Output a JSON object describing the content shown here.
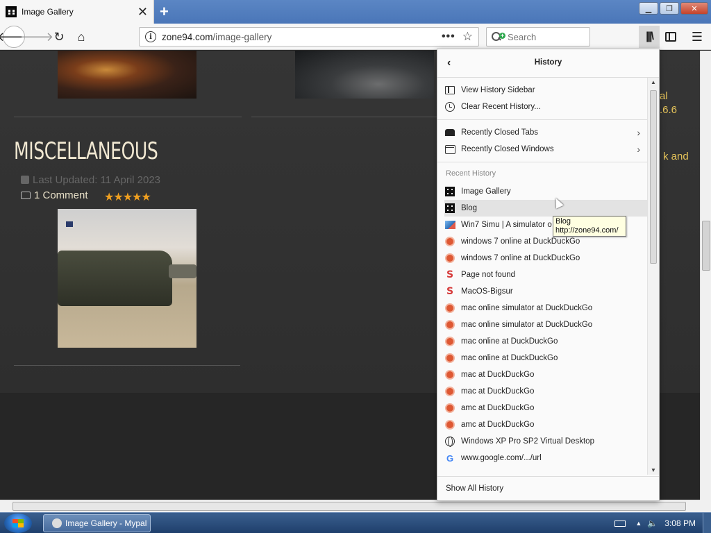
{
  "browser": {
    "tab_title": "Image Gallery",
    "tab_close": "✕",
    "new_tab": "+",
    "url_host": "zone94.com",
    "url_path": "/image-gallery",
    "search_placeholder": "Search",
    "window_controls": {
      "minimize": "▁",
      "maximize": "❐",
      "close": "✕"
    }
  },
  "page": {
    "section_title": "MISCELLANEOUS",
    "last_updated": "Last Updated: 11 April 2023",
    "comments": "1 Comment",
    "rating": "★★★★★",
    "right_snippets": [
      "al",
      ".6.6",
      "k and"
    ]
  },
  "history_panel": {
    "title": "History",
    "actions": [
      {
        "label": "View History Sidebar",
        "icon": "sidebar-icon"
      },
      {
        "label": "Clear Recent History...",
        "icon": "clock-icon"
      }
    ],
    "closed": [
      {
        "label": "Recently Closed Tabs",
        "icon": "tab-icon"
      },
      {
        "label": "Recently Closed Windows",
        "icon": "window-icon"
      }
    ],
    "recent_label": "Recent History",
    "items": [
      {
        "label": "Image Gallery",
        "icon": "zone94"
      },
      {
        "label": "Blog",
        "icon": "zone94",
        "hover": true
      },
      {
        "label": "Win7 Simu | A simulator o",
        "icon": "win7"
      },
      {
        "label": "windows 7 online at DuckDuckGo",
        "icon": "ddg"
      },
      {
        "label": "windows 7 online at DuckDuckGo",
        "icon": "ddg"
      },
      {
        "label": "Page not found",
        "icon": "s"
      },
      {
        "label": "MacOS-Bigsur",
        "icon": "s"
      },
      {
        "label": "mac online simulator at DuckDuckGo",
        "icon": "ddg"
      },
      {
        "label": "mac online simulator at DuckDuckGo",
        "icon": "ddg"
      },
      {
        "label": "mac online at DuckDuckGo",
        "icon": "ddg"
      },
      {
        "label": "mac online at DuckDuckGo",
        "icon": "ddg"
      },
      {
        "label": "mac at DuckDuckGo",
        "icon": "ddg"
      },
      {
        "label": "mac at DuckDuckGo",
        "icon": "ddg"
      },
      {
        "label": "amc at DuckDuckGo",
        "icon": "ddg"
      },
      {
        "label": "amc at DuckDuckGo",
        "icon": "ddg"
      },
      {
        "label": "Windows XP Pro SP2 Virtual Desktop",
        "icon": "globe"
      },
      {
        "label": "www.google.com/.../url",
        "icon": "google"
      }
    ],
    "footer": "Show All History"
  },
  "tooltip": {
    "title": "Blog",
    "url": "http://zone94.com/"
  },
  "taskbar": {
    "task_label": "Image Gallery - Mypal",
    "clock": "3:08 PM"
  },
  "colors": {
    "accent": "#4a76b8",
    "page_bg": "#2b2b2b",
    "heading": "#f1e8d2",
    "star": "#f0a020"
  }
}
